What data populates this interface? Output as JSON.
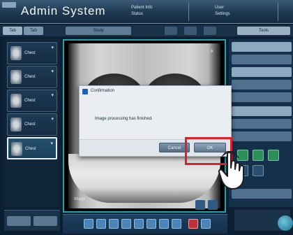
{
  "app": {
    "title": "Admin System"
  },
  "header": {
    "info_a": [
      "Patient Info",
      "Status"
    ],
    "info_b": [
      "User",
      "Settings"
    ]
  },
  "tabs": [
    "Tab",
    "Tab",
    "Study",
    "",
    "",
    "",
    "Tools"
  ],
  "thumbnails": [
    {
      "label": "Chest"
    },
    {
      "label": "Chest"
    },
    {
      "label": "Chest"
    },
    {
      "label": "Chest"
    },
    {
      "label": "Chest"
    }
  ],
  "viewer": {
    "caption": "Image"
  },
  "dialog": {
    "title": "Confirmation",
    "message": "Image processing has finished.",
    "cancel_label": "Cancel",
    "ok_label": "OK"
  },
  "colors": {
    "highlight": "#d9212b",
    "accent": "#24a3a3"
  }
}
